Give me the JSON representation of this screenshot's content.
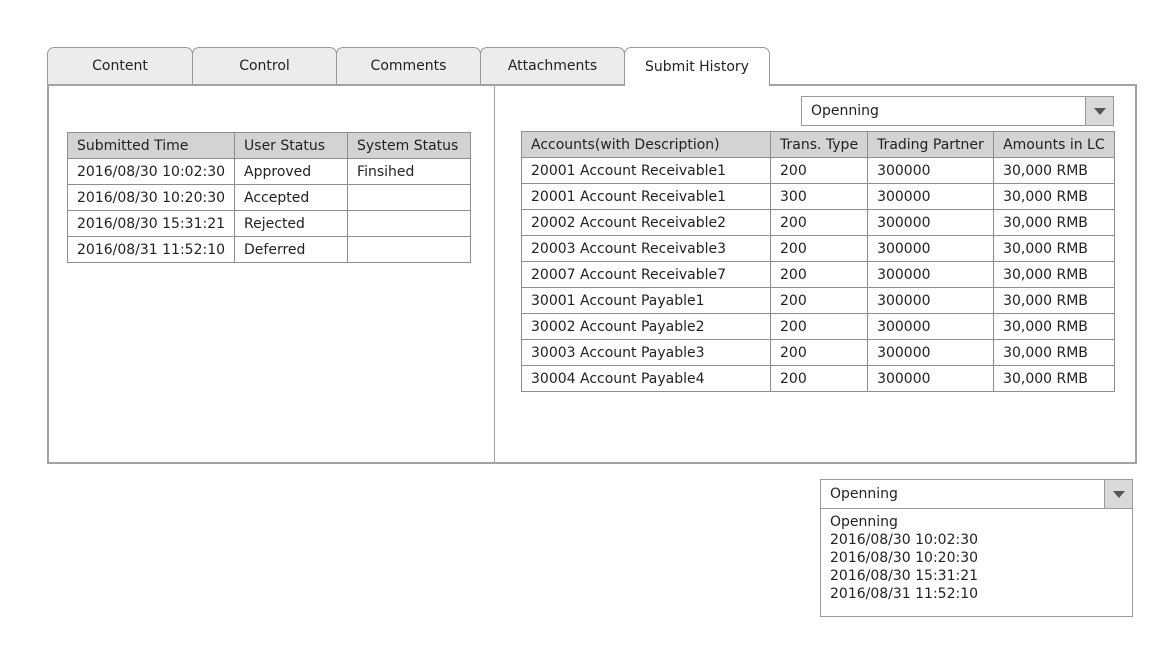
{
  "tabs": [
    "Content",
    "Control",
    "Comments",
    "Attachments",
    "Submit History"
  ],
  "active_tab": "Submit History",
  "history_table": {
    "headers": [
      "Submitted Time",
      "User Status",
      "System Status"
    ],
    "rows": [
      [
        "2016/08/30 10:02:30",
        "Approved",
        "Finsihed"
      ],
      [
        "2016/08/30 10:20:30",
        "Accepted",
        ""
      ],
      [
        "2016/08/30 15:31:21",
        "Rejected",
        ""
      ],
      [
        "2016/08/31 11:52:10",
        "Deferred",
        ""
      ]
    ]
  },
  "version_select": {
    "value": "Openning"
  },
  "accounts_table": {
    "headers": [
      "Accounts(with Description)",
      "Trans. Type",
      "Trading Partner",
      "Amounts in LC"
    ],
    "rows": [
      [
        "20001 Account Receivable1",
        "200",
        "300000",
        "30,000 RMB"
      ],
      [
        "20001 Account Receivable1",
        "300",
        "300000",
        "30,000 RMB"
      ],
      [
        "20002 Account Receivable2",
        "200",
        "300000",
        "30,000 RMB"
      ],
      [
        "20003 Account Receivable3",
        "200",
        "300000",
        "30,000 RMB"
      ],
      [
        "20007 Account Receivable7",
        "200",
        "300000",
        "30,000 RMB"
      ],
      [
        "30001 Account Payable1",
        "200",
        "300000",
        "30,000 RMB"
      ],
      [
        "30002 Account Payable2",
        "200",
        "300000",
        "30,000 RMB"
      ],
      [
        "30003 Account Payable3",
        "200",
        "300000",
        "30,000 RMB"
      ],
      [
        "30004 Account Payable4",
        "200",
        "300000",
        "30,000 RMB"
      ]
    ]
  },
  "expanded_select": {
    "value": "Openning",
    "options": [
      "Openning",
      "2016/08/30 10:02:30",
      "2016/08/30 10:20:30",
      "2016/08/30 15:31:21",
      "2016/08/31 11:52:10"
    ]
  },
  "icons": {
    "dropdown": "chevron-down-icon"
  },
  "colors": {
    "header_bg": "#d3d3d3",
    "tab_bg": "#ececec",
    "border": "#999999"
  }
}
